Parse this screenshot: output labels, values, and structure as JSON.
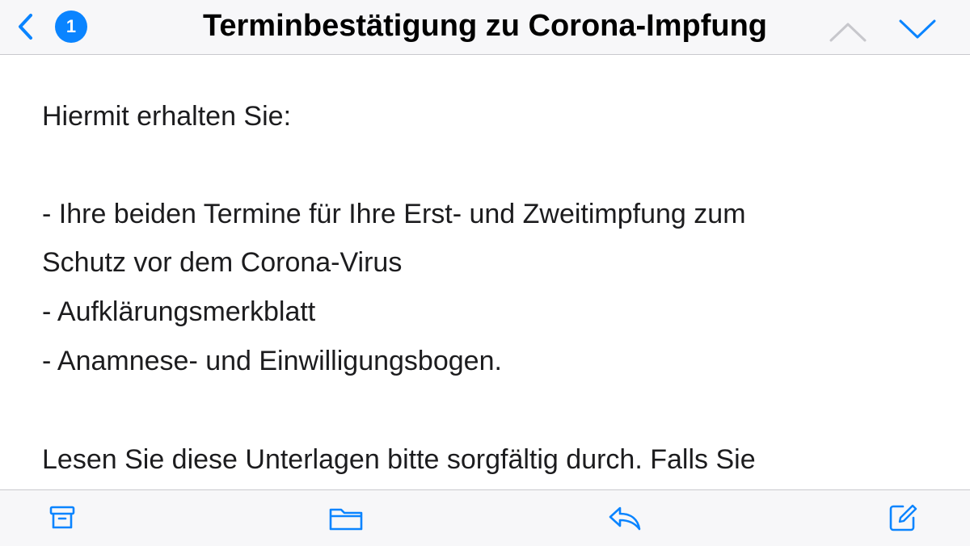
{
  "header": {
    "title": "Terminbestätigung zu Corona-Impfung",
    "unread_count": "1",
    "back_icon": "chevron-left-icon",
    "prev_icon": "chevron-up-icon",
    "next_icon": "chevron-down-icon"
  },
  "message": {
    "lines": [
      "Hiermit erhalten Sie:",
      "- Ihre beiden Termine für Ihre Erst- und Zweitimpfung zum",
      "Schutz vor dem Corona-Virus",
      "- Aufklärungsmerkblatt",
      "- Anamnese- und Einwilligungsbogen.",
      "Lesen Sie diese Unterlagen bitte sorgfältig durch. Falls Sie"
    ]
  },
  "toolbar": {
    "icons": [
      "archive-icon",
      "folder-icon",
      "reply-icon",
      "compose-icon"
    ]
  },
  "colors": {
    "accent": "#0a84ff",
    "bar_background": "#f7f7f9",
    "disabled": "#c7c7cc",
    "text": "#1c1c1e"
  }
}
